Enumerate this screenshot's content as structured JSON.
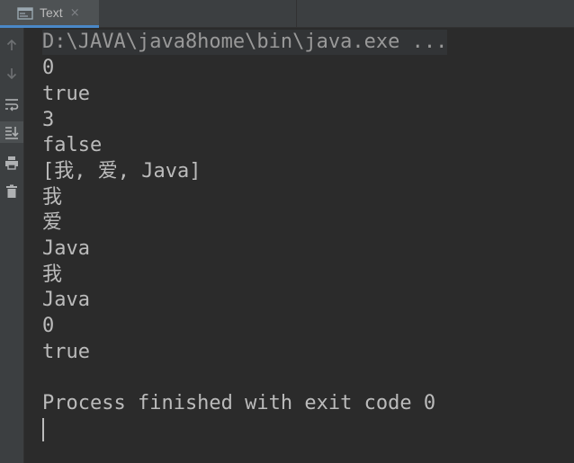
{
  "tab": {
    "label": "Text",
    "close": "×"
  },
  "toolbar": {
    "icons": [
      "arrow-up-icon",
      "arrow-down-icon",
      "soft-wrap-icon",
      "scroll-to-end-icon",
      "print-icon",
      "trash-icon"
    ]
  },
  "console": {
    "command": "D:\\JAVA\\java8home\\bin\\java.exe ...",
    "lines": [
      "0",
      "true",
      "3",
      "false",
      "[我, 爱, Java]",
      "我",
      "爱",
      "Java",
      "我",
      "Java",
      "0",
      "true"
    ],
    "blank": "",
    "exit_message": "Process finished with exit code 0"
  },
  "colors": {
    "background": "#2b2b2b",
    "panel": "#3c3f41",
    "text": "#bbbbbb",
    "accent": "#4a88c7"
  }
}
